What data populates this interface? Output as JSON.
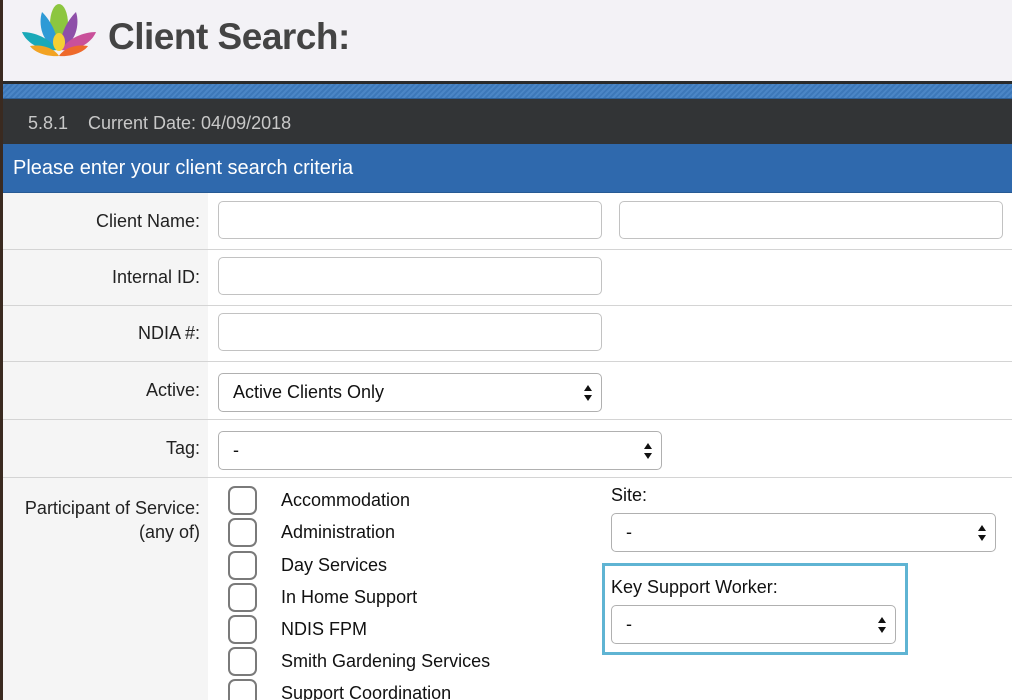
{
  "header": {
    "title": "Client Search:"
  },
  "version_bar": {
    "version": "5.8.1",
    "current_date": "Current Date: 04/09/2018"
  },
  "section_header": "Please enter your client search criteria",
  "form": {
    "client_name_label": "Client Name:",
    "client_first_value": "",
    "client_last_value": "",
    "internal_id_label": "Internal ID:",
    "internal_id_value": "",
    "ndia_label": "NDIA #:",
    "ndia_value": "",
    "active_label": "Active:",
    "active_selected": "Active Clients Only",
    "tag_label": "Tag:",
    "tag_selected": "-",
    "participant_label": "Participant of Service:",
    "participant_sublabel": "(any of)",
    "services": [
      "Accommodation",
      "Administration",
      "Day Services",
      "In Home Support",
      "NDIS FPM",
      "Smith Gardening Services",
      "Support Coordination"
    ],
    "site_label": "Site:",
    "site_selected": "-",
    "key_support_label": "Key Support Worker:",
    "key_support_selected": "-"
  },
  "colors": {
    "accent_blue": "#2f69ad",
    "dark_bar": "#323436",
    "highlight": "#5fb4d3"
  }
}
